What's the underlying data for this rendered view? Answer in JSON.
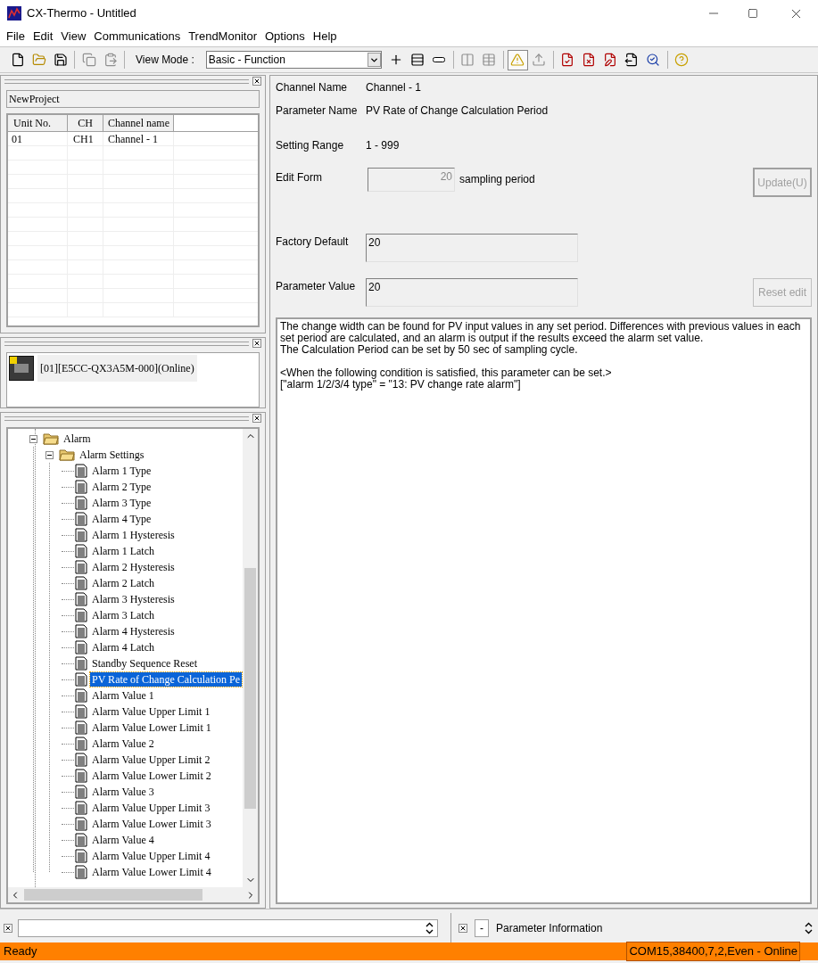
{
  "window": {
    "title": "CX-Thermo - Untitled"
  },
  "menu": [
    "File",
    "Edit",
    "View",
    "Communications",
    "TrendMonitor",
    "Options",
    "Help"
  ],
  "toolbar": {
    "left_buttons": [
      {
        "kind": "new",
        "disabled": false
      },
      {
        "kind": "open",
        "disabled": false
      },
      {
        "kind": "save",
        "disabled": false
      },
      {
        "kind": "copy",
        "disabled": true
      },
      {
        "kind": "paste",
        "disabled": true
      }
    ],
    "view_mode_label": "View Mode :",
    "view_mode_value": "Basic - Function",
    "right_buttons": [
      {
        "kind": "add",
        "disabled": false,
        "pressed": false
      },
      {
        "kind": "insert",
        "disabled": false,
        "pressed": false
      },
      {
        "kind": "remove",
        "disabled": false,
        "pressed": false
      },
      {
        "kind": "compare",
        "disabled": true,
        "pressed": false
      },
      {
        "kind": "table",
        "disabled": true,
        "pressed": false
      },
      {
        "kind": "warning",
        "disabled": false,
        "pressed": true
      },
      {
        "kind": "upload",
        "disabled": true,
        "pressed": false
      },
      {
        "kind": "doc-check",
        "disabled": false,
        "pressed": false
      },
      {
        "kind": "doc-cross",
        "disabled": false,
        "pressed": false
      },
      {
        "kind": "doc-edit",
        "disabled": false,
        "pressed": false
      },
      {
        "kind": "doc-send",
        "disabled": false,
        "pressed": false
      },
      {
        "kind": "find",
        "disabled": false,
        "pressed": false
      },
      {
        "kind": "help",
        "disabled": false,
        "pressed": false
      }
    ]
  },
  "project": {
    "name": "NewProject",
    "columns": [
      "Unit No.",
      "CH",
      "Channel name"
    ],
    "rows": [
      {
        "unit": "01",
        "ch": "CH1",
        "channel": "Channel - 1"
      }
    ]
  },
  "units": [
    {
      "label": "[01][E5CC-QX3A5M-000](Online)"
    }
  ],
  "tree": [
    {
      "label": "Alarm",
      "expanded": true,
      "selected": false,
      "children": [
        {
          "label": "Alarm Settings",
          "expanded": true,
          "selected": false,
          "children": [
            {
              "label": "Alarm 1 Type",
              "selected": false
            },
            {
              "label": "Alarm 2 Type",
              "selected": false
            },
            {
              "label": "Alarm 3 Type",
              "selected": false
            },
            {
              "label": "Alarm 4 Type",
              "selected": false
            },
            {
              "label": "Alarm 1 Hysteresis",
              "selected": false
            },
            {
              "label": "Alarm 1 Latch",
              "selected": false
            },
            {
              "label": "Alarm 2 Hysteresis",
              "selected": false
            },
            {
              "label": "Alarm 2 Latch",
              "selected": false
            },
            {
              "label": "Alarm 3 Hysteresis",
              "selected": false
            },
            {
              "label": "Alarm 3 Latch",
              "selected": false
            },
            {
              "label": "Alarm 4 Hysteresis",
              "selected": false
            },
            {
              "label": "Alarm 4 Latch",
              "selected": false
            },
            {
              "label": "Standby Sequence Reset",
              "selected": false
            },
            {
              "label": "PV Rate of Change Calculation Pe",
              "selected": true
            },
            {
              "label": "Alarm Value 1",
              "selected": false
            },
            {
              "label": "Alarm Value Upper Limit 1",
              "selected": false
            },
            {
              "label": "Alarm Value Lower Limit 1",
              "selected": false
            },
            {
              "label": "Alarm Value 2",
              "selected": false
            },
            {
              "label": "Alarm Value Upper Limit 2",
              "selected": false
            },
            {
              "label": "Alarm Value Lower Limit 2",
              "selected": false
            },
            {
              "label": "Alarm Value 3",
              "selected": false
            },
            {
              "label": "Alarm Value Upper Limit 3",
              "selected": false
            },
            {
              "label": "Alarm Value Lower Limit 3",
              "selected": false
            },
            {
              "label": "Alarm Value 4",
              "selected": false
            },
            {
              "label": "Alarm Value Upper Limit 4",
              "selected": false
            },
            {
              "label": "Alarm Value Lower Limit 4",
              "selected": false
            }
          ]
        }
      ]
    }
  ],
  "details": {
    "channel_name": {
      "label": "Channel Name",
      "value": "Channel - 1"
    },
    "parameter_name": {
      "label": "Parameter Name",
      "value": "PV Rate of Change Calculation Period"
    },
    "setting_range": {
      "label": "Setting Range",
      "value": "1 - 999"
    },
    "edit_form": {
      "label": "Edit Form",
      "value": "20",
      "unit": "sampling period",
      "disabled": true
    },
    "update_button": {
      "label": "Update(U)",
      "disabled": true
    },
    "factory_default": {
      "label": "Factory Default",
      "value": "20"
    },
    "parameter_value": {
      "label": "Parameter Value",
      "value": "20"
    },
    "reset_button": {
      "label": "Reset edit",
      "disabled": true
    },
    "description": [
      "The change width can be found for PV input values in any set period. Differences with previous values in each set period are calculated, and an alarm is output if the results exceed the alarm set value.",
      "The Calculation Period can be set by 50 sec of sampling cycle.",
      "<When the following condition is satisfied, this parameter can be set.>",
      "[\"alarm 1/2/3/4 type\" = \"13: PV change rate alarm\"]"
    ]
  },
  "dock": {
    "collapse_button": "-",
    "title": "Parameter Information"
  },
  "status_bar": {
    "message": "Ready",
    "connection": "COM15,38400,7,2,Even - Online"
  }
}
